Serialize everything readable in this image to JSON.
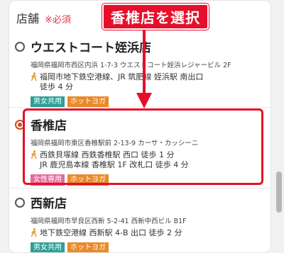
{
  "form": {
    "label": "店舗",
    "required": "※必須"
  },
  "annotation": {
    "callout": "香椎店を選択"
  },
  "stores": [
    {
      "name": "ウエストコート姪浜店",
      "address": "福岡県福岡市西区内浜 1-7-3 ウエストコート姪浜レジャービル 2F",
      "access": "福岡市地下鉄空港線、JR 筑肥線 姪浜駅 南出口\n徒歩 4 分",
      "tags": [
        "男女共用",
        "ホットヨガ"
      ],
      "selected": false
    },
    {
      "name": "香椎店",
      "address": "福岡県福岡市東区香椎駅前 2-13-9 カーサ・カッシーニ",
      "access": "西鉄貝塚線 西鉄香椎駅 西口 徒歩 1 分\nJR 鹿児島本線 香椎駅 1F 改札口 徒歩 4 分",
      "tags": [
        "女性専用",
        "ホットヨガ"
      ],
      "selected": true
    },
    {
      "name": "西新店",
      "address": "福岡県福岡市早良区西新 5-2-41 西新中西ビル B1F",
      "access": "地下鉄空港線 西新駅 4-B 出口 徒歩 2 分",
      "tags": [
        "男女共用",
        "ホットヨガ"
      ],
      "selected": false
    }
  ],
  "colors": {
    "accent_red": "#e60f2b",
    "selected_radio": "#d24a1e",
    "tag_mixed": "#2f9f95",
    "tag_hotyoga": "#ea8a2a",
    "tag_women": "#e36b9a"
  }
}
